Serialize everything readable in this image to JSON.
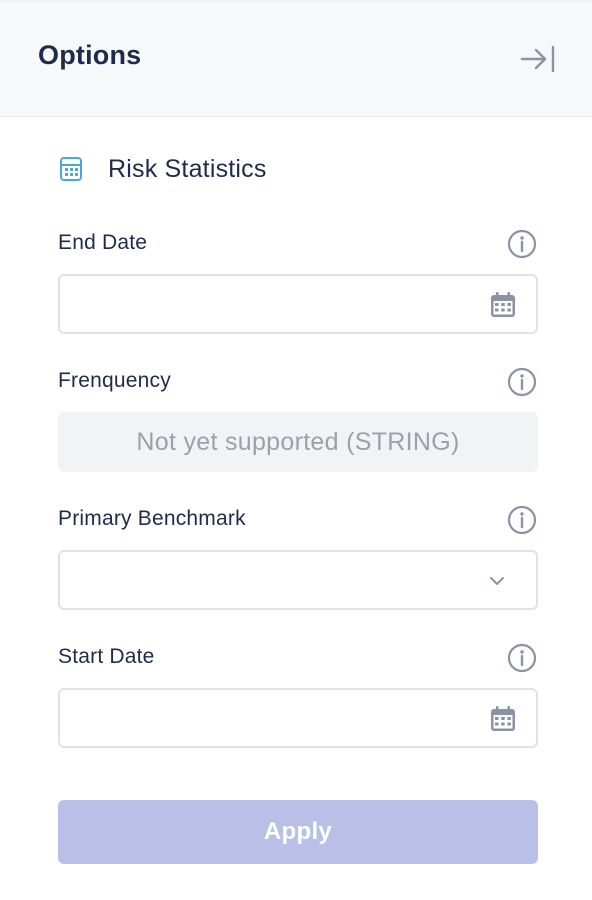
{
  "header": {
    "title": "Options",
    "collapse_icon": "collapse-right-icon"
  },
  "section": {
    "title": "Risk Statistics",
    "icon": "calculator-icon",
    "icon_color": "#4aa8d8"
  },
  "fields": {
    "end_date": {
      "label": "End Date",
      "value": "",
      "placeholder": "",
      "icon": "calendar-icon"
    },
    "frequency": {
      "label": "Frenquency",
      "unsupported_text": "Not yet supported (STRING)"
    },
    "primary_benchmark": {
      "label": "Primary Benchmark",
      "value": "",
      "icon": "chevron-down-icon"
    },
    "start_date": {
      "label": "Start Date",
      "value": "",
      "placeholder": "",
      "icon": "calendar-icon"
    }
  },
  "info_icon": "info-icon",
  "apply": {
    "label": "Apply",
    "color": "#b9bfe6"
  }
}
